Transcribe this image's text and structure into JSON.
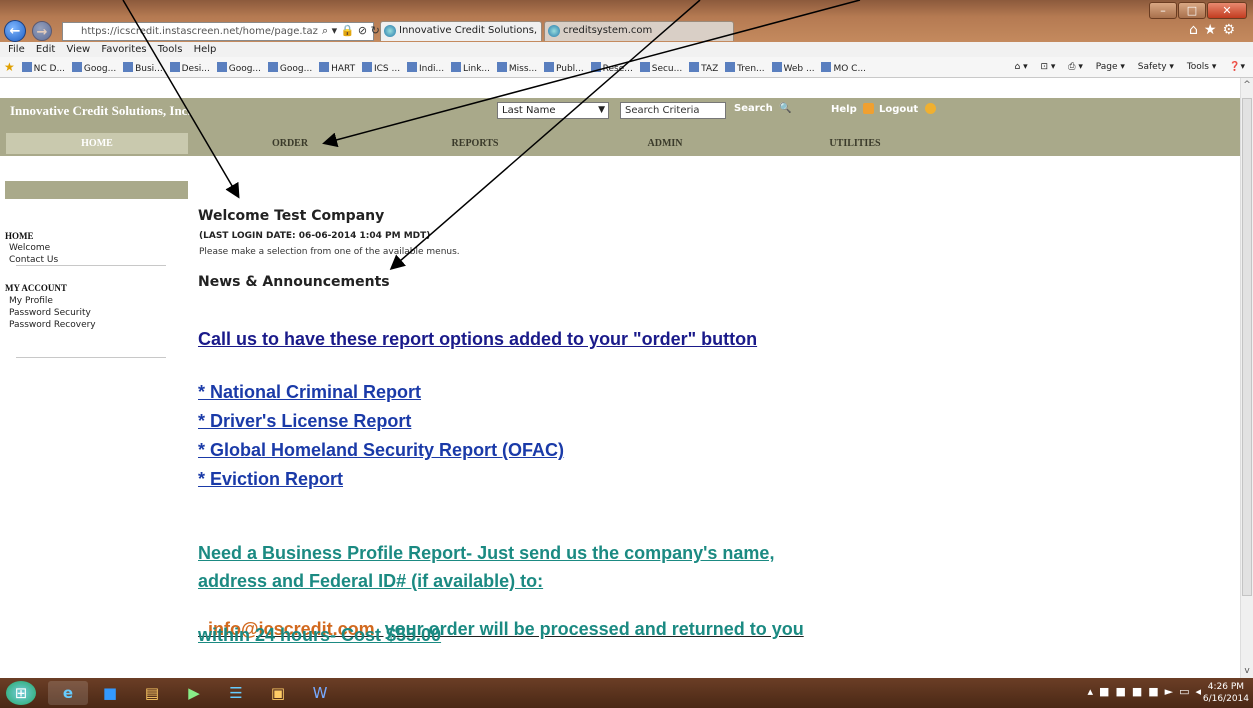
{
  "browser": {
    "address": "https://icscredit.instascreen.net/home/page.taz",
    "tabs": [
      {
        "label": "Innovative Credit Solutions, ..."
      },
      {
        "label": "creditsystem.com"
      }
    ],
    "menu": [
      "File",
      "Edit",
      "View",
      "Favorites",
      "Tools",
      "Help"
    ],
    "favorites": [
      "NC D...",
      "Goog...",
      "Busi...",
      "Desi...",
      "Goog...",
      "Goog...",
      "HART",
      "ICS ...",
      "Indi...",
      "Link...",
      "Miss...",
      "Publ...",
      "Rese...",
      "Secu...",
      "TAZ",
      "Tren...",
      "Web ...",
      "MO C..."
    ],
    "commands": [
      "Page ▾",
      "Safety ▾",
      "Tools ▾"
    ]
  },
  "site": {
    "brand": "Innovative Credit Solutions, Inc.",
    "search_select": "Last Name",
    "search_input": "Search Criteria",
    "search_label": "Search",
    "help_label": "Help",
    "logout_label": "Logout"
  },
  "nav": [
    "HOME",
    "ORDER",
    "REPORTS",
    "ADMIN",
    "UTILITIES"
  ],
  "sidebar": {
    "home_head": "HOME",
    "home_links": [
      "Welcome",
      "Contact Us"
    ],
    "account_head": "MY ACCOUNT",
    "account_links": [
      "My Profile",
      "Password Security",
      "Password Recovery"
    ]
  },
  "main": {
    "welcome": "Welcome Test Company",
    "last_login": "(LAST LOGIN DATE: 06-06-2014 1:04 PM MDT)",
    "intro": "Please make a selection from one of the available menus.",
    "news_heading": "News & Announcements",
    "call_line": "Call us to have these report options added to your \"order\" button",
    "reports": [
      "* National Criminal Report",
      "* Driver's License Report",
      "* Global Homeland Security Report (OFAC)",
      "* Eviction Report"
    ],
    "business_line1": "Need a Business Profile Report- Just send us the company's name,",
    "business_line2": "address and Federal ID# (if available) to:",
    "email": "info@icscredit.com",
    "business_line3": "  your order will be processed and returned to you",
    "business_line4": "within 24 hours- Cost $55.00"
  },
  "taskbar": {
    "time": "4:26 PM",
    "date": "6/16/2014"
  }
}
